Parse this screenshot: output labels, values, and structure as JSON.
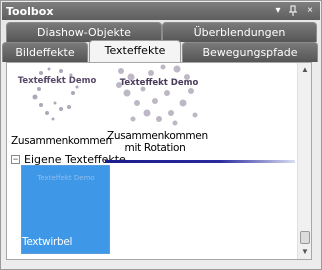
{
  "window": {
    "title": "Toolbox",
    "buttons": {
      "dropdown": "▾",
      "pin": "ᛒ",
      "close": "×"
    }
  },
  "tabs": {
    "row1": [
      "Diashow-Objekte",
      "Überblendungen"
    ],
    "row2": [
      "Bildeffekte",
      "Texteffekte",
      "Bewegungspfade"
    ],
    "active": "Texteffekte"
  },
  "effects": [
    {
      "label": "Zusammenkommen",
      "thumb_text": "Texteffekt Demo"
    },
    {
      "label": "Zusammenkommen mit Rotation",
      "thumb_text": "Texteffekt Demo"
    }
  ],
  "section": {
    "expander": "−",
    "label": "Eigene Texteffekte"
  },
  "custom_effects": [
    {
      "label": "Textwirbel",
      "thumb_text": "Texteffekt Demo",
      "selected": true
    }
  ],
  "scrollbar": {
    "up": "▲",
    "down": "▼"
  },
  "colors": {
    "selection": "#3f97e8",
    "section_bar": "#1c1c8c",
    "titlebar": "#6a6a6a"
  }
}
